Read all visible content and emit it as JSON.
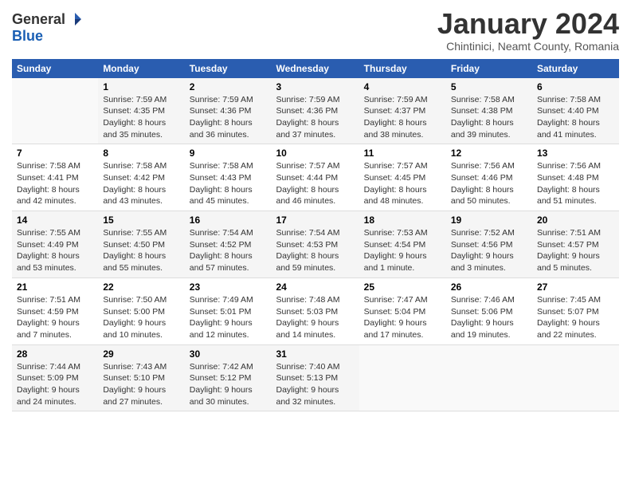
{
  "header": {
    "logo_line1": "General",
    "logo_line2": "Blue",
    "month": "January 2024",
    "location": "Chintinici, Neamt County, Romania"
  },
  "weekdays": [
    "Sunday",
    "Monday",
    "Tuesday",
    "Wednesday",
    "Thursday",
    "Friday",
    "Saturday"
  ],
  "weeks": [
    [
      {
        "day": "",
        "sunrise": "",
        "sunset": "",
        "daylight": ""
      },
      {
        "day": "1",
        "sunrise": "Sunrise: 7:59 AM",
        "sunset": "Sunset: 4:35 PM",
        "daylight": "Daylight: 8 hours and 35 minutes."
      },
      {
        "day": "2",
        "sunrise": "Sunrise: 7:59 AM",
        "sunset": "Sunset: 4:36 PM",
        "daylight": "Daylight: 8 hours and 36 minutes."
      },
      {
        "day": "3",
        "sunrise": "Sunrise: 7:59 AM",
        "sunset": "Sunset: 4:36 PM",
        "daylight": "Daylight: 8 hours and 37 minutes."
      },
      {
        "day": "4",
        "sunrise": "Sunrise: 7:59 AM",
        "sunset": "Sunset: 4:37 PM",
        "daylight": "Daylight: 8 hours and 38 minutes."
      },
      {
        "day": "5",
        "sunrise": "Sunrise: 7:58 AM",
        "sunset": "Sunset: 4:38 PM",
        "daylight": "Daylight: 8 hours and 39 minutes."
      },
      {
        "day": "6",
        "sunrise": "Sunrise: 7:58 AM",
        "sunset": "Sunset: 4:40 PM",
        "daylight": "Daylight: 8 hours and 41 minutes."
      }
    ],
    [
      {
        "day": "7",
        "sunrise": "Sunrise: 7:58 AM",
        "sunset": "Sunset: 4:41 PM",
        "daylight": "Daylight: 8 hours and 42 minutes."
      },
      {
        "day": "8",
        "sunrise": "Sunrise: 7:58 AM",
        "sunset": "Sunset: 4:42 PM",
        "daylight": "Daylight: 8 hours and 43 minutes."
      },
      {
        "day": "9",
        "sunrise": "Sunrise: 7:58 AM",
        "sunset": "Sunset: 4:43 PM",
        "daylight": "Daylight: 8 hours and 45 minutes."
      },
      {
        "day": "10",
        "sunrise": "Sunrise: 7:57 AM",
        "sunset": "Sunset: 4:44 PM",
        "daylight": "Daylight: 8 hours and 46 minutes."
      },
      {
        "day": "11",
        "sunrise": "Sunrise: 7:57 AM",
        "sunset": "Sunset: 4:45 PM",
        "daylight": "Daylight: 8 hours and 48 minutes."
      },
      {
        "day": "12",
        "sunrise": "Sunrise: 7:56 AM",
        "sunset": "Sunset: 4:46 PM",
        "daylight": "Daylight: 8 hours and 50 minutes."
      },
      {
        "day": "13",
        "sunrise": "Sunrise: 7:56 AM",
        "sunset": "Sunset: 4:48 PM",
        "daylight": "Daylight: 8 hours and 51 minutes."
      }
    ],
    [
      {
        "day": "14",
        "sunrise": "Sunrise: 7:55 AM",
        "sunset": "Sunset: 4:49 PM",
        "daylight": "Daylight: 8 hours and 53 minutes."
      },
      {
        "day": "15",
        "sunrise": "Sunrise: 7:55 AM",
        "sunset": "Sunset: 4:50 PM",
        "daylight": "Daylight: 8 hours and 55 minutes."
      },
      {
        "day": "16",
        "sunrise": "Sunrise: 7:54 AM",
        "sunset": "Sunset: 4:52 PM",
        "daylight": "Daylight: 8 hours and 57 minutes."
      },
      {
        "day": "17",
        "sunrise": "Sunrise: 7:54 AM",
        "sunset": "Sunset: 4:53 PM",
        "daylight": "Daylight: 8 hours and 59 minutes."
      },
      {
        "day": "18",
        "sunrise": "Sunrise: 7:53 AM",
        "sunset": "Sunset: 4:54 PM",
        "daylight": "Daylight: 9 hours and 1 minute."
      },
      {
        "day": "19",
        "sunrise": "Sunrise: 7:52 AM",
        "sunset": "Sunset: 4:56 PM",
        "daylight": "Daylight: 9 hours and 3 minutes."
      },
      {
        "day": "20",
        "sunrise": "Sunrise: 7:51 AM",
        "sunset": "Sunset: 4:57 PM",
        "daylight": "Daylight: 9 hours and 5 minutes."
      }
    ],
    [
      {
        "day": "21",
        "sunrise": "Sunrise: 7:51 AM",
        "sunset": "Sunset: 4:59 PM",
        "daylight": "Daylight: 9 hours and 7 minutes."
      },
      {
        "day": "22",
        "sunrise": "Sunrise: 7:50 AM",
        "sunset": "Sunset: 5:00 PM",
        "daylight": "Daylight: 9 hours and 10 minutes."
      },
      {
        "day": "23",
        "sunrise": "Sunrise: 7:49 AM",
        "sunset": "Sunset: 5:01 PM",
        "daylight": "Daylight: 9 hours and 12 minutes."
      },
      {
        "day": "24",
        "sunrise": "Sunrise: 7:48 AM",
        "sunset": "Sunset: 5:03 PM",
        "daylight": "Daylight: 9 hours and 14 minutes."
      },
      {
        "day": "25",
        "sunrise": "Sunrise: 7:47 AM",
        "sunset": "Sunset: 5:04 PM",
        "daylight": "Daylight: 9 hours and 17 minutes."
      },
      {
        "day": "26",
        "sunrise": "Sunrise: 7:46 AM",
        "sunset": "Sunset: 5:06 PM",
        "daylight": "Daylight: 9 hours and 19 minutes."
      },
      {
        "day": "27",
        "sunrise": "Sunrise: 7:45 AM",
        "sunset": "Sunset: 5:07 PM",
        "daylight": "Daylight: 9 hours and 22 minutes."
      }
    ],
    [
      {
        "day": "28",
        "sunrise": "Sunrise: 7:44 AM",
        "sunset": "Sunset: 5:09 PM",
        "daylight": "Daylight: 9 hours and 24 minutes."
      },
      {
        "day": "29",
        "sunrise": "Sunrise: 7:43 AM",
        "sunset": "Sunset: 5:10 PM",
        "daylight": "Daylight: 9 hours and 27 minutes."
      },
      {
        "day": "30",
        "sunrise": "Sunrise: 7:42 AM",
        "sunset": "Sunset: 5:12 PM",
        "daylight": "Daylight: 9 hours and 30 minutes."
      },
      {
        "day": "31",
        "sunrise": "Sunrise: 7:40 AM",
        "sunset": "Sunset: 5:13 PM",
        "daylight": "Daylight: 9 hours and 32 minutes."
      },
      {
        "day": "",
        "sunrise": "",
        "sunset": "",
        "daylight": ""
      },
      {
        "day": "",
        "sunrise": "",
        "sunset": "",
        "daylight": ""
      },
      {
        "day": "",
        "sunrise": "",
        "sunset": "",
        "daylight": ""
      }
    ]
  ]
}
